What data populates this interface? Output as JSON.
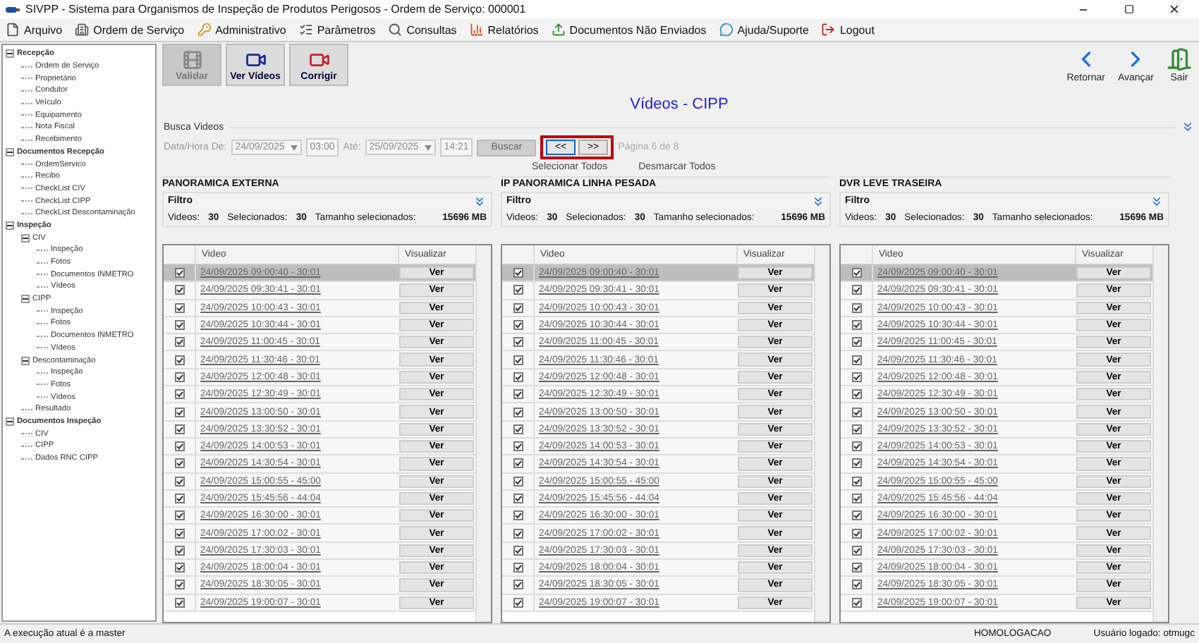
{
  "window": {
    "title": "SIVPP - Sistema para Organismos de Inspeção de Produtos Perigosos - Ordem de Serviço: 000001"
  },
  "menu": [
    {
      "label": "Arquivo",
      "kind": "file"
    },
    {
      "label": "Ordem de Serviço",
      "kind": "building"
    },
    {
      "label": "Administrativo",
      "kind": "key"
    },
    {
      "label": "Parâmetros",
      "kind": "list"
    },
    {
      "label": "Consultas",
      "kind": "search"
    },
    {
      "label": "Relatórios",
      "kind": "chart"
    },
    {
      "label": "Documentos Não Enviados",
      "kind": "upload"
    },
    {
      "label": "Ajuda/Suporte",
      "kind": "help"
    },
    {
      "label": "Logout",
      "kind": "logout"
    }
  ],
  "sidebar": {
    "items": [
      {
        "label": "Recepção",
        "expanded": true,
        "children": [
          {
            "label": "Ordem de Serviço"
          },
          {
            "label": "Proprietário"
          },
          {
            "label": "Condutor"
          },
          {
            "label": "Veículo"
          },
          {
            "label": "Equipamento"
          },
          {
            "label": "Nota Fiscal"
          },
          {
            "label": "Recebimento"
          }
        ]
      },
      {
        "label": "Documentos Recepção",
        "expanded": true,
        "children": [
          {
            "label": "OrdemServico"
          },
          {
            "label": "Recibo"
          },
          {
            "label": "CheckList CIV"
          },
          {
            "label": "CheckList CIPP"
          },
          {
            "label": "CheckList Descontaminação"
          }
        ]
      },
      {
        "label": "Inspeção",
        "expanded": true,
        "children": [
          {
            "label": "CIV",
            "expanded": true,
            "children": [
              {
                "label": "Inspeção"
              },
              {
                "label": "Fotos"
              },
              {
                "label": "Documentos INMETRO"
              },
              {
                "label": "Vídeos"
              }
            ]
          },
          {
            "label": "CIPP",
            "expanded": true,
            "children": [
              {
                "label": "Inspeção"
              },
              {
                "label": "Fotos"
              },
              {
                "label": "Documentos INMETRO"
              },
              {
                "label": "Vídeos"
              }
            ]
          },
          {
            "label": "Descontaminação",
            "expanded": true,
            "children": [
              {
                "label": "Inspeção"
              },
              {
                "label": "Fotos"
              },
              {
                "label": "Vídeos"
              }
            ]
          },
          {
            "label": "Resultado"
          }
        ]
      },
      {
        "label": "Documentos Inspeção",
        "expanded": true,
        "children": [
          {
            "label": "CIV"
          },
          {
            "label": "CIPP"
          },
          {
            "label": "Dados RNC CIPP"
          }
        ]
      }
    ]
  },
  "toolbar": {
    "left": [
      {
        "label": "Validar",
        "kind": "validate",
        "disabled": true
      },
      {
        "label": "Ver Vídeos",
        "kind": "camera",
        "disabled": false
      },
      {
        "label": "Corrigir",
        "kind": "fix",
        "disabled": false
      }
    ],
    "right": [
      {
        "label": "Retornar",
        "kind": "back"
      },
      {
        "label": "Avançar",
        "kind": "forward"
      },
      {
        "label": "Sair",
        "kind": "exit"
      }
    ]
  },
  "page_title": "Vídeos - CIPP",
  "search": {
    "title": "Busca Videos",
    "from_label": "Data/Hora De:",
    "from_date": "24/09/2025",
    "from_time": "03:00",
    "to_label": "Até:",
    "to_date": "25/09/2025",
    "to_time": "14:21",
    "search_button": "Buscar",
    "pager": {
      "highlighted": true,
      "buttons": [
        {
          "label": "<<",
          "focused": true
        },
        {
          "label": ">>",
          "focused": false
        }
      ],
      "info": "Página 6 de 8"
    },
    "select_all": "Selecionar Todos",
    "deselect_all": "Desmarcar Todos"
  },
  "panels": [
    {
      "title": "PANORAMICA EXTERNA",
      "filter": "Filtro",
      "videos_label": "Videos:",
      "videos": "30",
      "selected_label": "Selecionados:",
      "selected_count": "30",
      "size_label": "Tamanho selecionados:",
      "size": "15696 MB",
      "columns": [
        "Video",
        "Visualizar"
      ],
      "rows": [
        {
          "checked": true,
          "selected": true,
          "video": "24/09/2025 09:00:40 - 30:01",
          "action": "Ver"
        },
        {
          "checked": true,
          "selected": false,
          "video": "24/09/2025 09:30:41 - 30:01",
          "action": "Ver"
        },
        {
          "checked": true,
          "selected": false,
          "video": "24/09/2025 10:00:43 - 30:01",
          "action": "Ver"
        },
        {
          "checked": true,
          "selected": false,
          "video": "24/09/2025 10:30:44 - 30:01",
          "action": "Ver"
        },
        {
          "checked": true,
          "selected": false,
          "video": "24/09/2025 11:00:45 - 30:01",
          "action": "Ver"
        },
        {
          "checked": true,
          "selected": false,
          "video": "24/09/2025 11:30:46 - 30:01",
          "action": "Ver"
        },
        {
          "checked": true,
          "selected": false,
          "video": "24/09/2025 12:00:48 - 30:01",
          "action": "Ver"
        },
        {
          "checked": true,
          "selected": false,
          "video": "24/09/2025 12:30:49 - 30:01",
          "action": "Ver"
        },
        {
          "checked": true,
          "selected": false,
          "video": "24/09/2025 13:00:50 - 30:01",
          "action": "Ver"
        },
        {
          "checked": true,
          "selected": false,
          "video": "24/09/2025 13:30:52 - 30:01",
          "action": "Ver"
        },
        {
          "checked": true,
          "selected": false,
          "video": "24/09/2025 14:00:53 - 30:01",
          "action": "Ver"
        },
        {
          "checked": true,
          "selected": false,
          "video": "24/09/2025 14:30:54 - 30:01",
          "action": "Ver"
        },
        {
          "checked": true,
          "selected": false,
          "video": "24/09/2025 15:00:55 - 45:00",
          "action": "Ver"
        },
        {
          "checked": true,
          "selected": false,
          "video": "24/09/2025 15:45:56 - 44:04",
          "action": "Ver"
        },
        {
          "checked": true,
          "selected": false,
          "video": "24/09/2025 16:30:00 - 30:01",
          "action": "Ver"
        },
        {
          "checked": true,
          "selected": false,
          "video": "24/09/2025 17:00:02 - 30:01",
          "action": "Ver"
        },
        {
          "checked": true,
          "selected": false,
          "video": "24/09/2025 17:30:03 - 30:01",
          "action": "Ver"
        },
        {
          "checked": true,
          "selected": false,
          "video": "24/09/2025 18:00:04 - 30:01",
          "action": "Ver"
        },
        {
          "checked": true,
          "selected": false,
          "video": "24/09/2025 18:30:05 - 30:01",
          "action": "Ver"
        },
        {
          "checked": true,
          "selected": false,
          "video": "24/09/2025 19:00:07 - 30:01",
          "action": "Ver"
        }
      ]
    },
    {
      "title": "IP PANORAMICA LINHA PESADA",
      "filter": "Filtro",
      "videos_label": "Videos:",
      "videos": "30",
      "selected_label": "Selecionados:",
      "selected_count": "30",
      "size_label": "Tamanho selecionados:",
      "size": "15696 MB",
      "columns": [
        "Video",
        "Visualizar"
      ],
      "rows": [
        {
          "checked": true,
          "selected": true,
          "video": "24/09/2025 09:00:40 - 30:01",
          "action": "Ver"
        },
        {
          "checked": true,
          "selected": false,
          "video": "24/09/2025 09:30:41 - 30:01",
          "action": "Ver"
        },
        {
          "checked": true,
          "selected": false,
          "video": "24/09/2025 10:00:43 - 30:01",
          "action": "Ver"
        },
        {
          "checked": true,
          "selected": false,
          "video": "24/09/2025 10:30:44 - 30:01",
          "action": "Ver"
        },
        {
          "checked": true,
          "selected": false,
          "video": "24/09/2025 11:00:45 - 30:01",
          "action": "Ver"
        },
        {
          "checked": true,
          "selected": false,
          "video": "24/09/2025 11:30:46 - 30:01",
          "action": "Ver"
        },
        {
          "checked": true,
          "selected": false,
          "video": "24/09/2025 12:00:48 - 30:01",
          "action": "Ver"
        },
        {
          "checked": true,
          "selected": false,
          "video": "24/09/2025 12:30:49 - 30:01",
          "action": "Ver"
        },
        {
          "checked": true,
          "selected": false,
          "video": "24/09/2025 13:00:50 - 30:01",
          "action": "Ver"
        },
        {
          "checked": true,
          "selected": false,
          "video": "24/09/2025 13:30:52 - 30:01",
          "action": "Ver"
        },
        {
          "checked": true,
          "selected": false,
          "video": "24/09/2025 14:00:53 - 30:01",
          "action": "Ver"
        },
        {
          "checked": true,
          "selected": false,
          "video": "24/09/2025 14:30:54 - 30:01",
          "action": "Ver"
        },
        {
          "checked": true,
          "selected": false,
          "video": "24/09/2025 15:00:55 - 45:00",
          "action": "Ver"
        },
        {
          "checked": true,
          "selected": false,
          "video": "24/09/2025 15:45:56 - 44:04",
          "action": "Ver"
        },
        {
          "checked": true,
          "selected": false,
          "video": "24/09/2025 16:30:00 - 30:01",
          "action": "Ver"
        },
        {
          "checked": true,
          "selected": false,
          "video": "24/09/2025 17:00:02 - 30:01",
          "action": "Ver"
        },
        {
          "checked": true,
          "selected": false,
          "video": "24/09/2025 17:30:03 - 30:01",
          "action": "Ver"
        },
        {
          "checked": true,
          "selected": false,
          "video": "24/09/2025 18:00:04 - 30:01",
          "action": "Ver"
        },
        {
          "checked": true,
          "selected": false,
          "video": "24/09/2025 18:30:05 - 30:01",
          "action": "Ver"
        },
        {
          "checked": true,
          "selected": false,
          "video": "24/09/2025 19:00:07 - 30:01",
          "action": "Ver"
        }
      ]
    },
    {
      "title": "DVR LEVE TRASEIRA",
      "filter": "Filtro",
      "videos_label": "Videos:",
      "videos": "30",
      "selected_label": "Selecionados:",
      "selected_count": "30",
      "size_label": "Tamanho selecionados:",
      "size": "15696 MB",
      "columns": [
        "Video",
        "Visualizar"
      ],
      "rows": [
        {
          "checked": true,
          "selected": true,
          "video": "24/09/2025 09:00:40 - 30:01",
          "action": "Ver"
        },
        {
          "checked": true,
          "selected": false,
          "video": "24/09/2025 09:30:41 - 30:01",
          "action": "Ver"
        },
        {
          "checked": true,
          "selected": false,
          "video": "24/09/2025 10:00:43 - 30:01",
          "action": "Ver"
        },
        {
          "checked": true,
          "selected": false,
          "video": "24/09/2025 10:30:44 - 30:01",
          "action": "Ver"
        },
        {
          "checked": true,
          "selected": false,
          "video": "24/09/2025 11:00:45 - 30:01",
          "action": "Ver"
        },
        {
          "checked": true,
          "selected": false,
          "video": "24/09/2025 11:30:46 - 30:01",
          "action": "Ver"
        },
        {
          "checked": true,
          "selected": false,
          "video": "24/09/2025 12:00:48 - 30:01",
          "action": "Ver"
        },
        {
          "checked": true,
          "selected": false,
          "video": "24/09/2025 12:30:49 - 30:01",
          "action": "Ver"
        },
        {
          "checked": true,
          "selected": false,
          "video": "24/09/2025 13:00:50 - 30:01",
          "action": "Ver"
        },
        {
          "checked": true,
          "selected": false,
          "video": "24/09/2025 13:30:52 - 30:01",
          "action": "Ver"
        },
        {
          "checked": true,
          "selected": false,
          "video": "24/09/2025 14:00:53 - 30:01",
          "action": "Ver"
        },
        {
          "checked": true,
          "selected": false,
          "video": "24/09/2025 14:30:54 - 30:01",
          "action": "Ver"
        },
        {
          "checked": true,
          "selected": false,
          "video": "24/09/2025 15:00:55 - 45:00",
          "action": "Ver"
        },
        {
          "checked": true,
          "selected": false,
          "video": "24/09/2025 15:45:56 - 44:04",
          "action": "Ver"
        },
        {
          "checked": true,
          "selected": false,
          "video": "24/09/2025 16:30:00 - 30:01",
          "action": "Ver"
        },
        {
          "checked": true,
          "selected": false,
          "video": "24/09/2025 17:00:02 - 30:01",
          "action": "Ver"
        },
        {
          "checked": true,
          "selected": false,
          "video": "24/09/2025 17:30:03 - 30:01",
          "action": "Ver"
        },
        {
          "checked": true,
          "selected": false,
          "video": "24/09/2025 18:00:04 - 30:01",
          "action": "Ver"
        },
        {
          "checked": true,
          "selected": false,
          "video": "24/09/2025 18:30:05 - 30:01",
          "action": "Ver"
        },
        {
          "checked": true,
          "selected": false,
          "video": "24/09/2025 19:00:07 - 30:01",
          "action": "Ver"
        }
      ]
    }
  ],
  "status_bar": {
    "message": "A execução atual é a master",
    "environment": "HOMOLOGACAO",
    "user": "Usuário logado: otmugc"
  }
}
